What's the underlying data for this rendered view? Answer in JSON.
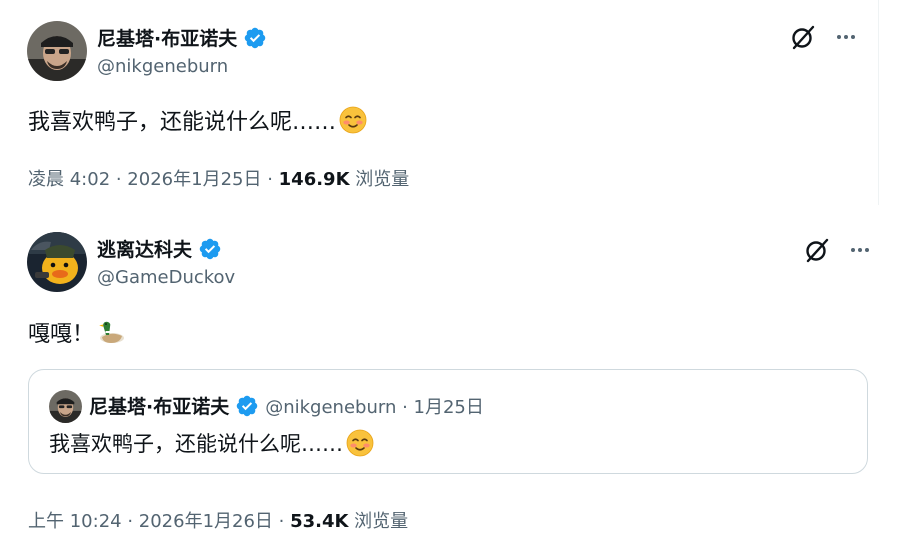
{
  "tweet1": {
    "author_name": "尼基塔·布亚诺夫",
    "handle": "@nikgeneburn",
    "text": "我喜欢鸭子，还能说什么呢……",
    "time": "凌晨 4:02 · 2026年1月25日 · ",
    "views": "146.9K",
    "views_label": " 浏览量"
  },
  "tweet2": {
    "author_name": "逃离达科夫",
    "handle": "@GameDuckov",
    "text": "嘎嘎！",
    "time": "上午 10:24 · 2026年1月26日 · ",
    "views": "53.4K",
    "views_label": " 浏览量",
    "quote": {
      "author_name": "尼基塔·布亚诺夫",
      "handle_date": "@nikgeneburn · 1月25日",
      "text": "我喜欢鸭子，还能说什么呢……"
    }
  },
  "icons": {
    "verified": "verified-badge-icon",
    "grok": "grok-icon",
    "more": "more-options-icon",
    "emoji_smile": "smiling-face-emoji",
    "emoji_duck": "duck-emoji"
  },
  "colors": {
    "verified_blue": "#1d9bf0",
    "secondary_text": "#536471",
    "border": "#cfd9de"
  }
}
